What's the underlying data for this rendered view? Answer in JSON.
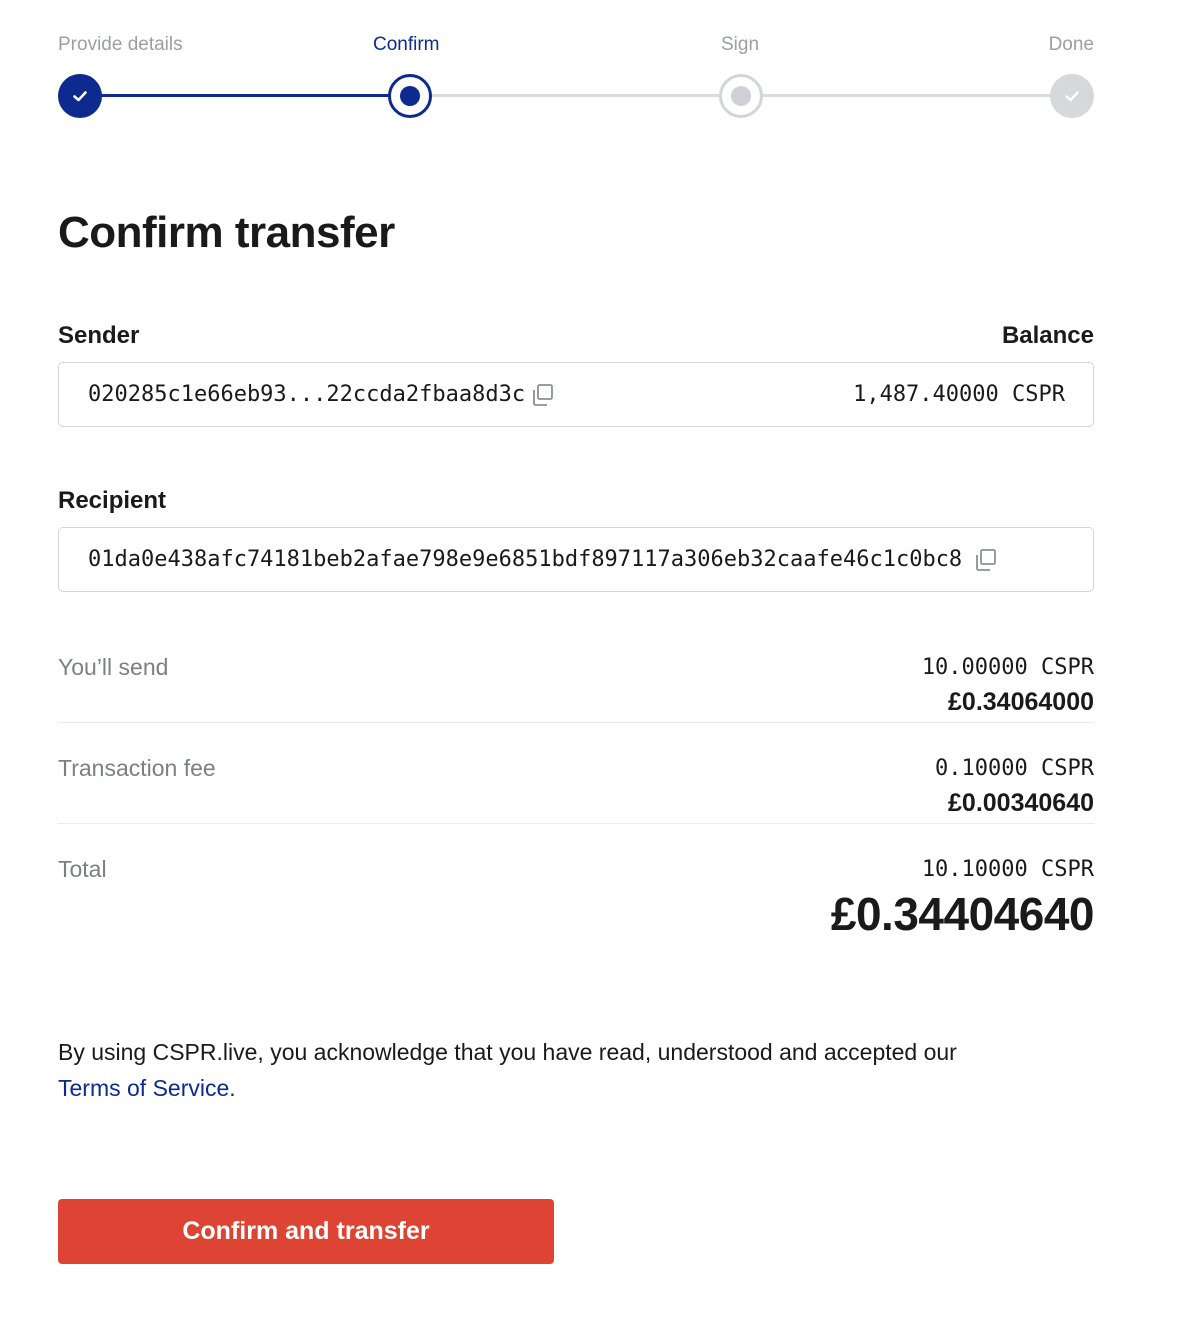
{
  "stepper": {
    "steps": [
      {
        "label": "Provide details",
        "state": "done"
      },
      {
        "label": "Confirm",
        "state": "current"
      },
      {
        "label": "Sign",
        "state": "pending"
      },
      {
        "label": "Done",
        "state": "pending"
      }
    ],
    "colors": {
      "active": "#0d2a8f",
      "inactive": "#9a9ea6",
      "track": "#d9dbe0"
    }
  },
  "title": "Confirm transfer",
  "sender": {
    "label": "Sender",
    "address": "020285c1e66eb93...22ccda2fbaa8d3c",
    "copy_icon": "copy-icon"
  },
  "balance": {
    "label": "Balance",
    "value": "1,487.40000 CSPR"
  },
  "recipient": {
    "label": "Recipient",
    "address": "01da0e438afc74181beb2afae798e9e6851bdf897117a306eb32caafe46c1c0bc8",
    "copy_icon": "copy-icon"
  },
  "summary": {
    "send": {
      "label": "You’ll send",
      "crypto": "10.00000 CSPR",
      "fiat": "£0.34064000"
    },
    "fee": {
      "label": "Transaction fee",
      "crypto": "0.10000 CSPR",
      "fiat": "£0.00340640"
    },
    "total": {
      "label": "Total",
      "crypto": "10.10000 CSPR",
      "fiat": "£0.34404640"
    }
  },
  "terms": {
    "text": "By using CSPR.live, you acknowledge that you have read, understood and accepted our",
    "link_label": "Terms of Service."
  },
  "confirm_button": {
    "label": "Confirm and transfer",
    "color": "#de4433"
  }
}
